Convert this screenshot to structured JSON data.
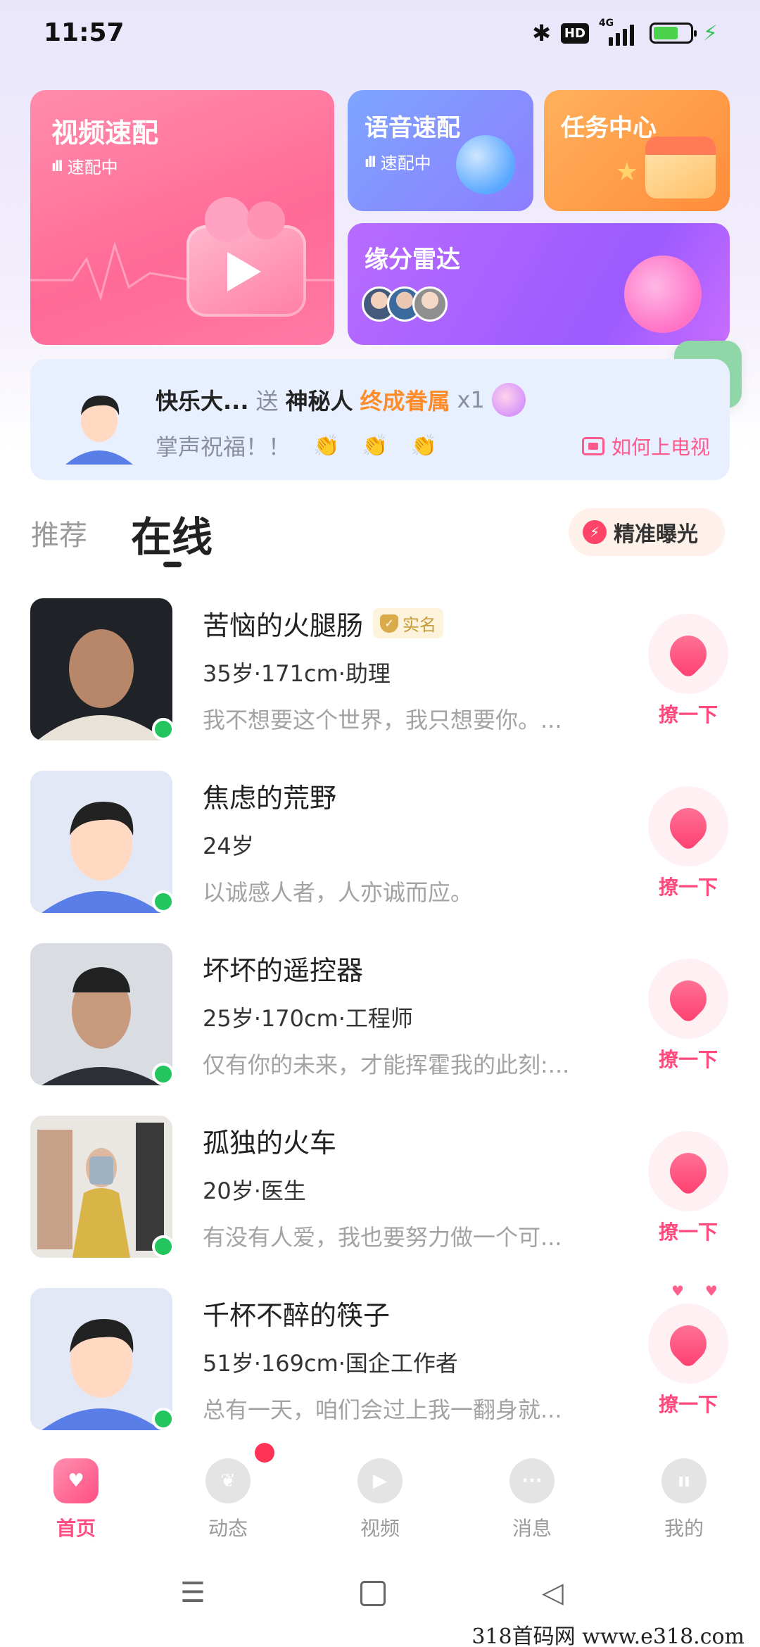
{
  "status_bar": {
    "time": "11:57",
    "network": "4G",
    "hd": "HD"
  },
  "cards": {
    "video": {
      "title": "视频速配",
      "sub": "速配中"
    },
    "voice": {
      "title": "语音速配",
      "sub": "速配中"
    },
    "task": {
      "title": "任务中心"
    },
    "radar": {
      "title": "缘分雷达"
    }
  },
  "gift_banner": {
    "sender": "快乐大...",
    "verb": "送",
    "receiver": "神秘人",
    "gift": "终成眷属",
    "count": "x1",
    "message": "掌声祝福！！",
    "how_to_tv": "如何上电视"
  },
  "tabs": {
    "recommend": "推荐",
    "online": "在线"
  },
  "exposure_button": "精准曝光",
  "users": [
    {
      "name": "苦恼的火腿肠",
      "verified": "实名",
      "meta": "35岁·171cm·助理",
      "bio": "我不想要这个世界，我只想要你。...",
      "action": "撩一下"
    },
    {
      "name": "焦虑的荒野",
      "meta": "24岁",
      "bio": "以诚感人者，人亦诚而应。",
      "action": "撩一下"
    },
    {
      "name": "坏坏的遥控器",
      "meta": "25岁·170cm·工程师",
      "bio": "仅有你的未来，才能挥霍我的此刻:...",
      "action": "撩一下"
    },
    {
      "name": "孤独的火车",
      "meta": "20岁·医生",
      "bio": "有没有人爱，我也要努力做一个可...",
      "action": "撩一下"
    },
    {
      "name": "千杯不醉的筷子",
      "meta": "51岁·169cm·国企工作者",
      "bio": "总有一天，咱们会过上我一翻身就...",
      "action": "撩一下"
    }
  ],
  "bottom_nav": [
    "首页",
    "动态",
    "视频",
    "消息",
    "我的"
  ],
  "icons": {
    "float_more": "more-dots-icon",
    "exposure": "lightning-icon",
    "flirt": "heart-hand-icon",
    "verified": "shield-check-icon"
  },
  "colors": {
    "accent": "#ff4f83",
    "online": "#22c55e",
    "gift_item": "#ff8c2a"
  },
  "watermark": "318首码网 www.e318.com"
}
